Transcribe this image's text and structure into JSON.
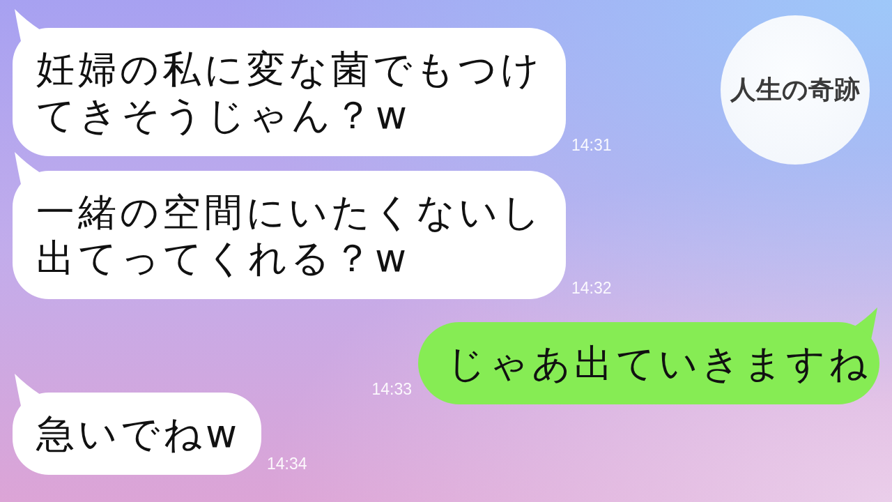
{
  "channel_logo": {
    "text": "人生の奇跡"
  },
  "messages": [
    {
      "kind": "received",
      "text": "妊婦の私に変な菌でもつけてきそうじゃん？w",
      "time": "14:31"
    },
    {
      "kind": "received",
      "text": "一緒の空間にいたくないし出てってくれる？w",
      "time": "14:32"
    },
    {
      "kind": "sent",
      "text": "じゃあ出ていきますね",
      "time": "14:33"
    },
    {
      "kind": "received",
      "text": "急いでねw",
      "time": "14:34"
    }
  ]
}
